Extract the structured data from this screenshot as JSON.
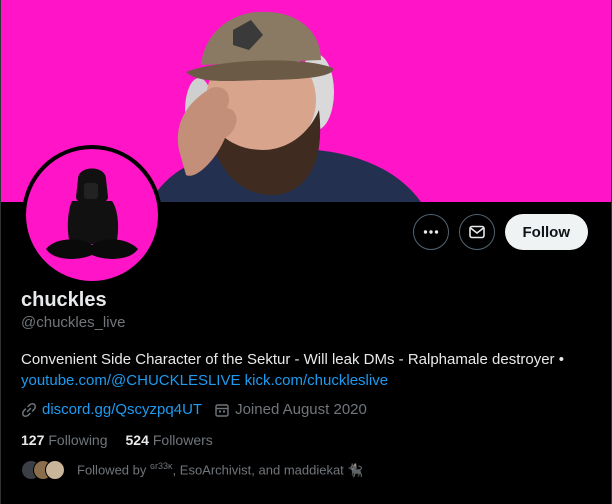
{
  "profile": {
    "name": "chuckles",
    "handle": "@chuckles_live",
    "bio_text": "Convenient Side Character of the Sektur - Will leak DMs - Ralphamale destroyer •",
    "bio_link1": "youtube.com/@CHUCKLESLIVE",
    "bio_link2": "kick.com/chuckleslive",
    "website": "discord.gg/Qscyzpq4UT",
    "joined": "Joined August 2020"
  },
  "stats": {
    "following_count": "127",
    "following_label": "Following",
    "followers_count": "524",
    "followers_label": "Followers"
  },
  "followed_by": {
    "prefix": "Followed by",
    "sup": "ɢr33ᴋ",
    "rest": ", EsoArchivist, and maddiekat 🐈‍⬛"
  },
  "actions": {
    "follow_label": "Follow"
  },
  "colors": {
    "banner": "#ff14c8",
    "link": "#1d9bf0"
  }
}
